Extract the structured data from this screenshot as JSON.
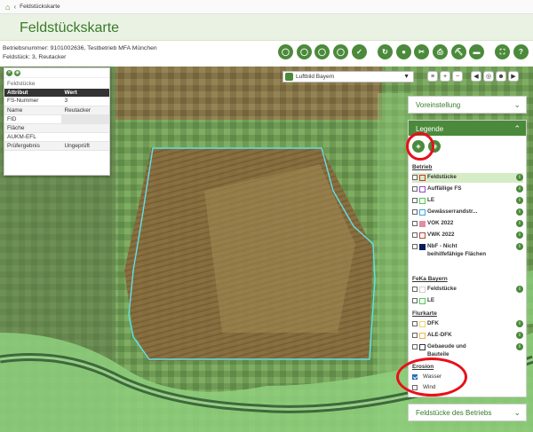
{
  "breadcrumb": {
    "current": "Feldstückskarte"
  },
  "page": {
    "title": "Feldstückskarte"
  },
  "info": {
    "line1": "Betriebsnummer: 9101002636, Testbetrieb MFA München",
    "line2": "Feldstück: 3, Reutacker"
  },
  "toolbar": {
    "icons": [
      "field-tool-1-icon",
      "field-tool-2-icon",
      "field-tool-3-icon",
      "field-tool-4-icon",
      "field-tool-5-icon",
      "measure-1-icon",
      "measure-2-icon",
      "crop-icon",
      "print-icon",
      "tools-icon",
      "ruler-icon",
      "fullscreen-icon",
      "help-icon"
    ]
  },
  "attributes": {
    "caption": "Feldstücke",
    "col_attr": "Attribut",
    "col_value": "Wert",
    "rows": [
      {
        "name": "FS-Nummer",
        "value": "3"
      },
      {
        "name": "Name",
        "value": "Reutacker"
      },
      {
        "name": "FID",
        "value": ""
      },
      {
        "name": "Fläche",
        "value": ""
      },
      {
        "name": "AUKM-EFL",
        "value": ""
      },
      {
        "name": "Prüfergebnis",
        "value": "Ungeprüft"
      }
    ]
  },
  "map": {
    "layer": "Luftbild Bayern"
  },
  "panels": {
    "voreinstellung": "Voreinstellung",
    "legende": "Legende",
    "feldstuecke_betrieb": "Feldstücke des Betriebs"
  },
  "legend": {
    "betrieb": {
      "title": "Betrieb",
      "items": [
        {
          "label": "Feldstücke",
          "color": "#d93030",
          "selected": true
        },
        {
          "label": "Auffällige FS",
          "color": "#8a4fd0"
        },
        {
          "label": "LE",
          "color": "#4ec94e"
        },
        {
          "label": "Gewässerrandstr...",
          "color": "#3da5e0"
        },
        {
          "label": "VOK 2022",
          "color": "#e58ca0"
        },
        {
          "label": "VWK 2022",
          "color": "#b04a3a"
        },
        {
          "label": "NbF - Nicht beihilfefähige Flächen",
          "color": "#0a1a5a"
        }
      ]
    },
    "feka": {
      "title": "FeKa Bayern",
      "items": [
        {
          "label": "Feldstücke",
          "color": "#cfcfcf"
        },
        {
          "label": "LE",
          "color": "#4ec94e"
        }
      ]
    },
    "flurkarte": {
      "title": "Flurkarte",
      "items": [
        {
          "label": "DFK",
          "color": "#f2d36b"
        },
        {
          "label": "ALE-DFK",
          "color": "#f5b34a"
        },
        {
          "label": "Gebaeude und Bauteile",
          "color": "#333333"
        }
      ]
    },
    "erosion": {
      "title": "Erosion",
      "items": [
        {
          "label": "Wasser",
          "checked": true
        },
        {
          "label": "Wind",
          "checked": false
        }
      ]
    }
  },
  "colors": {
    "accent": "#4b8a3b",
    "annotation": "#e8101a",
    "boundary": "#62e0e6"
  }
}
